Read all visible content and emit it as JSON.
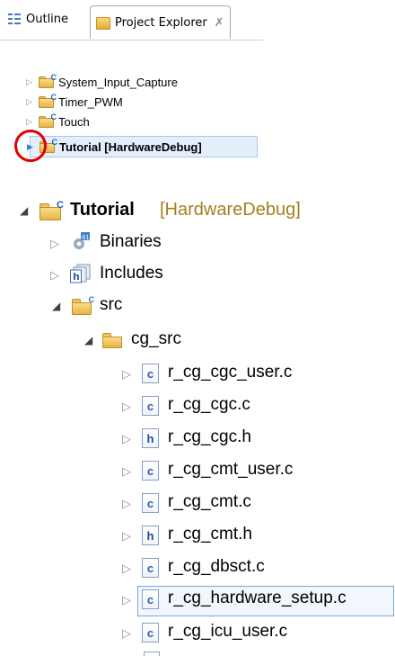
{
  "tabs": {
    "outline_label": "Outline",
    "project_label": "Project Explorer",
    "close_symbol": "✗"
  },
  "small_tree": {
    "items": [
      {
        "label": "System_Input_Capture"
      },
      {
        "label": "Timer_PWM"
      },
      {
        "label": "Touch"
      },
      {
        "label": "Tutorial [HardwareDebug]",
        "selected": true
      }
    ]
  },
  "big_tree": {
    "project_name": "Tutorial",
    "project_config": "[HardwareDebug]",
    "binaries_label": "Binaries",
    "includes_label": "Includes",
    "src_label": "src",
    "cg_src_label": "cg_src",
    "files": [
      {
        "name": "r_cg_cgc_user.c",
        "type": "c"
      },
      {
        "name": "r_cg_cgc.c",
        "type": "c"
      },
      {
        "name": "r_cg_cgc.h",
        "type": "h"
      },
      {
        "name": "r_cg_cmt_user.c",
        "type": "c"
      },
      {
        "name": "r_cg_cmt.c",
        "type": "c"
      },
      {
        "name": "r_cg_cmt.h",
        "type": "h"
      },
      {
        "name": "r_cg_dbsct.c",
        "type": "c"
      },
      {
        "name": "r_cg_hardware_setup.c",
        "type": "c",
        "highlighted": true
      },
      {
        "name": "r_cg_icu_user.c",
        "type": "c"
      }
    ]
  },
  "colors": {
    "highlight_ring": "#e00000",
    "selection": "#e4effc",
    "config_text": "#a77e1e"
  }
}
